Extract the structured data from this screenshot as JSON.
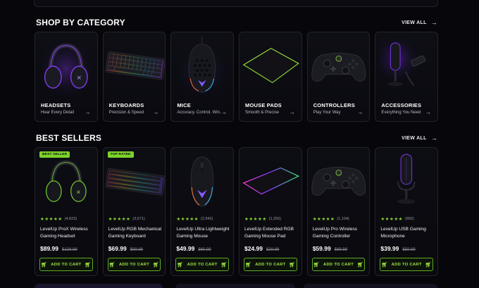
{
  "categories_section": {
    "title": "SHOP BY CATEGORY",
    "view_all": "VIEW ALL"
  },
  "categories": [
    {
      "label": "HEADSETS",
      "sub": "Hear Every Detail",
      "icon": "headset-icon"
    },
    {
      "label": "KEYBOARDS",
      "sub": "Precision & Speed",
      "icon": "keyboard-icon"
    },
    {
      "label": "MICE",
      "sub": "Accuracy. Control. Win.",
      "icon": "mouse-icon"
    },
    {
      "label": "MOUSE PADS",
      "sub": "Smooth & Precise",
      "icon": "mousepad-icon"
    },
    {
      "label": "CONTROLLERS",
      "sub": "Play Your Way",
      "icon": "controller-icon"
    },
    {
      "label": "ACCESSORIES",
      "sub": "Everything You Need",
      "icon": "microphone-icon"
    }
  ],
  "bestsellers_section": {
    "title": "BEST SELLERS",
    "view_all": "VIEW ALL"
  },
  "products": [
    {
      "badge": "BEST SELLER",
      "count": "(4,823)",
      "name": "LevelUp ProX Wireless Gaming Headset",
      "price": "$89.99",
      "old_price": "$129.99",
      "cta": "ADD TO CART",
      "rating": 4.5
    },
    {
      "badge": "TOP RATED",
      "count": "(3,671)",
      "name": "LevelUp RGB Mechanical Gaming Keyboard",
      "price": "$69.99",
      "old_price": "$99.99",
      "cta": "ADD TO CART",
      "rating": 4.5
    },
    {
      "badge": "",
      "count": "(2,942)",
      "name": "LevelUp Ultra Lightweight Gaming Mouse",
      "price": "$49.99",
      "old_price": "$69.99",
      "cta": "ADD TO CART",
      "rating": 4.5
    },
    {
      "badge": "",
      "count": "(1,256)",
      "name": "LevelUp Extended RGB Gaming Mouse Pad",
      "price": "$24.99",
      "old_price": "$39.99",
      "cta": "ADD TO CART",
      "rating": 4.5
    },
    {
      "badge": "",
      "count": "(1,104)",
      "name": "LevelUp Pro Wireless Gaming Controller",
      "price": "$59.99",
      "old_price": "$89.99",
      "cta": "ADD TO CART",
      "rating": 4.5
    },
    {
      "badge": "",
      "count": "(892)",
      "name": "LevelUp USB Gaming Microphone",
      "price": "$39.99",
      "old_price": "$59.99",
      "cta": "ADD TO CART",
      "rating": 4.5
    }
  ],
  "colors": {
    "accent": "#8ad530",
    "purple_glow": "#8a3df0",
    "background": "#07070b"
  }
}
